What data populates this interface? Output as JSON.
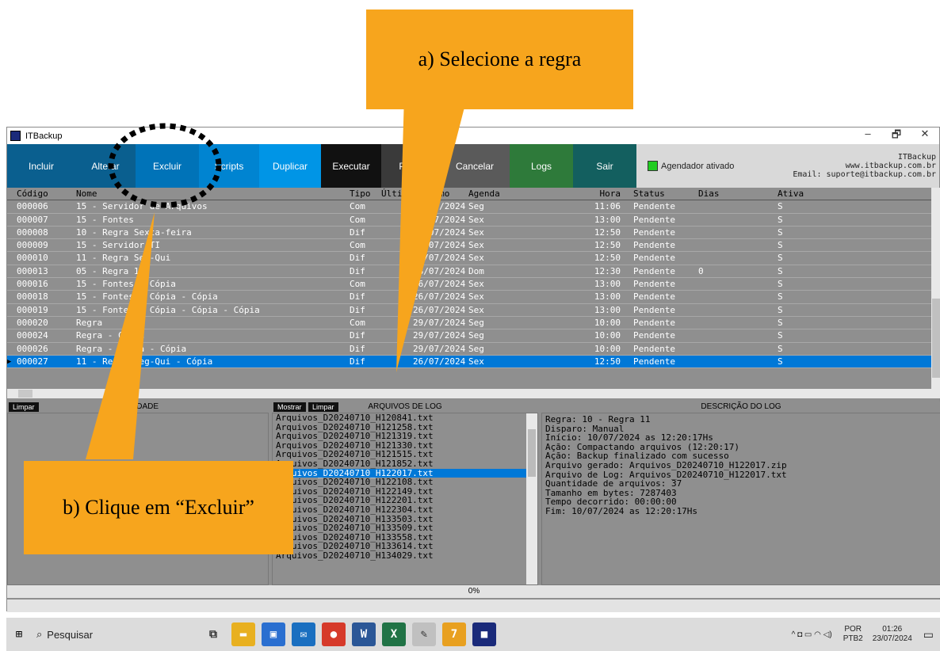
{
  "window": {
    "title": "ITBackup",
    "controls": [
      "–",
      "🗗",
      "✕"
    ]
  },
  "toolbar": {
    "buttons": [
      {
        "label": "Incluir",
        "color": "#0a5f8f",
        "w": 86
      },
      {
        "label": "Alterar",
        "color": "#0a5f8f",
        "w": 76
      },
      {
        "label": "Excluir",
        "color": "#0073b8",
        "w": 80
      },
      {
        "label": "Scripts",
        "color": "#0084d1",
        "w": 76
      },
      {
        "label": "Duplicar",
        "color": "#0095e6",
        "w": 78
      },
      {
        "label": "Executar",
        "color": "#111111",
        "w": 76
      },
      {
        "label": "Parar",
        "color": "#3a3a3a",
        "w": 74
      },
      {
        "label": "Cancelar",
        "color": "#5a5a5a",
        "w": 88
      },
      {
        "label": "Logs",
        "color": "#2e7a3a",
        "w": 80
      },
      {
        "label": "Sair",
        "color": "#135f5f",
        "w": 80
      }
    ],
    "scheduler": "Agendador ativado",
    "site": [
      "ITBackup",
      "www.itbackup.com.br",
      "Email: suporte@itbackup.com.br"
    ]
  },
  "grid": {
    "columns": [
      "",
      "Código",
      "Nome",
      "Tipo",
      "Último",
      "Próximo",
      "Agenda",
      "Hora",
      "Status",
      "Dias",
      "Ativa"
    ],
    "rows": [
      [
        "000006",
        "15 - Servidor de Arquivos",
        "Com",
        "",
        "29/07/2024",
        "Seg",
        "11:06",
        "Pendente",
        "",
        "S"
      ],
      [
        "000007",
        "15 - Fontes",
        "Com",
        "",
        "26/07/2024",
        "Sex",
        "13:00",
        "Pendente",
        "",
        "S"
      ],
      [
        "000008",
        "10 - Regra Sexta-feira",
        "Dif",
        "",
        "26/07/2024",
        "Sex",
        "12:50",
        "Pendente",
        "",
        "S"
      ],
      [
        "000009",
        "15 - Servidor TI",
        "Com",
        "",
        "26/07/2024",
        "Sex",
        "12:50",
        "Pendente",
        "",
        "S"
      ],
      [
        "000010",
        "11 - Regra Seg-Qui",
        "Dif",
        "",
        "26/07/2024",
        "Sex",
        "12:50",
        "Pendente",
        "",
        "S"
      ],
      [
        "000013",
        "05 - Regra 1",
        "Dif",
        "",
        "28/07/2024",
        "Dom",
        "12:30",
        "Pendente",
        "0",
        "S"
      ],
      [
        "000016",
        "15 - Fontes - Cópia",
        "Com",
        "",
        "26/07/2024",
        "Sex",
        "13:00",
        "Pendente",
        "",
        "S"
      ],
      [
        "000018",
        "15 - Fontes - Cópia - Cópia",
        "Dif",
        "",
        "26/07/2024",
        "Sex",
        "13:00",
        "Pendente",
        "",
        "S"
      ],
      [
        "000019",
        "15 - Fontes - Cópia - Cópia - Cópia",
        "Dif",
        "",
        "26/07/2024",
        "Sex",
        "13:00",
        "Pendente",
        "",
        "S"
      ],
      [
        "000020",
        "Regra",
        "Com",
        "",
        "29/07/2024",
        "Seg",
        "10:00",
        "Pendente",
        "",
        "S"
      ],
      [
        "000024",
        "Regra - Cópia",
        "Dif",
        "",
        "29/07/2024",
        "Seg",
        "10:00",
        "Pendente",
        "",
        "S"
      ],
      [
        "000026",
        "Regra - Cópia - Cópia",
        "Dif",
        "",
        "29/07/2024",
        "Seg",
        "10:00",
        "Pendente",
        "",
        "S"
      ],
      [
        "000027",
        "11 - Regra Seg-Qui - Cópia",
        "Dif",
        "",
        "26/07/2024",
        "Sex",
        "12:50",
        "Pendente",
        "",
        "S"
      ]
    ],
    "selected_index": 12
  },
  "activity": {
    "clear": "Limpar",
    "title": "ATIVIDADE"
  },
  "files": {
    "show": "Mostrar",
    "clear": "Limpar",
    "title": "ARQUIVOS DE LOG",
    "selected_index": 6,
    "items": [
      "Arquivos_D20240710_H120841.txt",
      "Arquivos_D20240710_H121258.txt",
      "Arquivos_D20240710_H121319.txt",
      "Arquivos_D20240710_H121330.txt",
      "Arquivos_D20240710_H121515.txt",
      "Arquivos_D20240710_H121852.txt",
      "Arquivos_D20240710_H122017.txt",
      "Arquivos_D20240710_H122108.txt",
      "Arquivos_D20240710_H122149.txt",
      "Arquivos_D20240710_H122201.txt",
      "Arquivos_D20240710_H122304.txt",
      "Arquivos_D20240710_H133503.txt",
      "Arquivos_D20240710_H133509.txt",
      "Arquivos_D20240710_H133558.txt",
      "Arquivos_D20240710_H133614.txt",
      "Arquivos_D20240710_H134029.txt"
    ]
  },
  "desc": {
    "title": "DESCRIÇÃO DO LOG",
    "lines": [
      "Regra: 10 - Regra 11",
      "Disparo: Manual",
      "Início: 10/07/2024 as 12:20:17Hs",
      "Ação: Compactando arquivos (12:20:17)",
      "Ação: Backup finalizado com sucesso",
      "Arquivo gerado: Arquivos_D20240710_H122017.zip",
      "Arquivo de Log: Arquivos_D20240710_H122017.txt",
      "Quantidade de arquivos: 37",
      "Tamanho em bytes: 7287403",
      "Tempo decorrido: 00:00:00",
      "Fim: 10/07/2024 as 12:20:17Hs"
    ]
  },
  "progress": {
    "label": "0%",
    "value": 0
  },
  "taskbar": {
    "search": "Pesquisar",
    "lang": [
      "POR",
      "PTB2"
    ],
    "time": "01:26",
    "date": "23/07/2024",
    "apps": [
      {
        "name": "task-view-icon",
        "glyph": "⧉",
        "color": "#dcdcdc"
      },
      {
        "name": "file-explorer-icon",
        "glyph": "▬",
        "color": "#e8b020"
      },
      {
        "name": "store-icon",
        "glyph": "▣",
        "color": "#2a6fd0"
      },
      {
        "name": "mail-icon",
        "glyph": "✉",
        "color": "#1a6fc0"
      },
      {
        "name": "chrome-icon",
        "glyph": "●",
        "color": "#d63a2a"
      },
      {
        "name": "word-icon",
        "glyph": "W",
        "color": "#2b5797"
      },
      {
        "name": "excel-icon",
        "glyph": "X",
        "color": "#217346"
      },
      {
        "name": "paint-icon",
        "glyph": "✎",
        "color": "#c0c0c0"
      },
      {
        "name": "7zip-icon",
        "glyph": "7",
        "color": "#e8a020"
      },
      {
        "name": "itbackup-taskbar-icon",
        "glyph": "■",
        "color": "#1a2a7a"
      }
    ]
  },
  "callouts": {
    "a": "a) Selecione a regra",
    "b": "b) Clique em “Excluir”"
  }
}
